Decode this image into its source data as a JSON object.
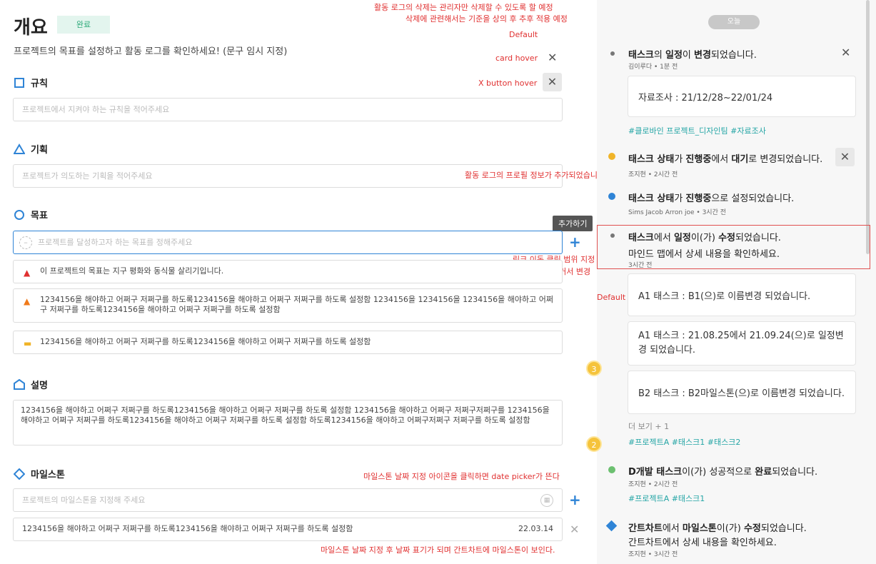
{
  "header": {
    "title": "개요",
    "status_badge": "완료",
    "subtitle": "프로젝트의 목표를 설정하고 활동 로그를 확인하세요! (문구 임시 지정)"
  },
  "sections": {
    "rules": {
      "label": "규칙",
      "placeholder": "프로젝트에서 지켜야 하는 규칙을 적어주세요"
    },
    "plan": {
      "label": "기획",
      "placeholder": "프로젝트가 의도하는 기획을 적어주세요"
    },
    "goal": {
      "label": "목표",
      "placeholder": "프로젝트를 달성하고자 하는 목표를 정해주세요",
      "add_tooltip": "추가하기",
      "items": [
        "이 프로젝트의 목표는 지구 평화와 동식물 살리기입니다.",
        "1234156을 해야하고 어쩌구 저쩌구를 하도록1234156을 해야하고 어쩌구 저쩌구를 하도록 설정함 1234156을 1234156을 1234156을 해야하고 어쩌구 저쩌구를 하도록1234156을 해야하고 어쩌구 저쩌구를 하도록 설정함",
        "1234156을 해야하고 어쩌구 저쩌구를 하도록1234156을 해야하고 어쩌구 저쩌구를 하도록 설정함"
      ]
    },
    "description": {
      "label": "설명",
      "text": "1234156을 해야하고 어쩌구 저쩌구를 하도록1234156을 해야하고 어쩌구 저쩌구를 하도록 설정함 1234156을 해야하고 어쩌구 저쩌구저쩌구를 1234156을 해야하고 어쩌구 저쩌구를 하도록1234156을 해야하고 어쩌구 저쩌구를 하도록 설정함 하도록1234156을 해야하고 어쩌구저쩌구 저쩌구를 하도록 설정함"
    },
    "milestone": {
      "label": "마일스톤",
      "placeholder": "프로젝트의 마일스톤을 지정해 주세요",
      "items": [
        {
          "text": "1234156을 해야하고 어쩌구 저쩌구를 하도록1234156을 해야하고 어쩌구 저쩌구를 하도록 설정함",
          "date": "22.03.14"
        }
      ]
    }
  },
  "annotations": {
    "delete_note_1": "활동 로그의 삭제는 관리자만 삭제할 수 있도록 할 예정",
    "delete_note_2": "삭제에 관련해서는 기준을 상의 후 추후 적용 예정",
    "default_1": "Default",
    "card_hover": "card hover",
    "x_button_hover": "X button hover",
    "profile_note": "활동 로그의 프로필 정보가 추가되었습니다.",
    "link_note": "링크 이동 클릭 범위 지정",
    "hover_note": "해당 텍스트 영역에 호버시 마우스 커서 변경",
    "default_2": "Default",
    "datepicker_note": "마일스톤 날짜 지정 아이콘을 클릭하면 date picker가 뜬다",
    "milestone_after_note": "마일스톤 날짜 지정 후 날짜 표기가 되며 간트차트에 마일스톤이 보인다."
  },
  "timeline": {
    "today_label": "오늘",
    "entries": [
      {
        "title_parts": [
          "태스크",
          "의 ",
          "일정",
          "이 ",
          "변경",
          "되었습니다."
        ],
        "meta": "김이루다 • 1분 전",
        "card": "자료조사 : 21/12/28~22/01/24",
        "tags": "#클로바인 프로젝트_디자인팀   #자료조사"
      },
      {
        "title_parts": [
          "태스크 상태",
          "가 ",
          "진행중",
          "에서 ",
          "대기",
          "로 변경되었습니다."
        ],
        "meta": "조지현 • 2시간 전"
      },
      {
        "title_parts": [
          "태스크 상태",
          "가 ",
          "진행중",
          "으로 설정되었습니다."
        ],
        "meta": "Sims Jacob Arron joe • 3시간 전"
      },
      {
        "title_parts": [
          "태스크",
          "에서 ",
          "일정",
          "이(가) ",
          "수정",
          "되었습니다."
        ],
        "line2": "마인드 맵에서 상세 내용을 확인하세요.",
        "meta": "3시간 전",
        "cards": [
          "A1 태스크 : B1(으)로 이름변경 되었습니다.",
          "A1 태스크 : 21.08.25에서 21.09.24(으)로 일정변경 되었습니다.",
          "B2 태스크 :  B2마일스톤(으)로 이름변경 되었습니다."
        ],
        "more": "더 보기 + 1",
        "tags": "#프로젝트A   #태스크1   #태스크2"
      },
      {
        "title_parts": [
          "D개발 태스크",
          "이(가) 성공적으로 ",
          "완료",
          "되었습니다."
        ],
        "meta": "조지현 • 2시간 전",
        "tags": "#프로젝트A   #태스크1"
      },
      {
        "title_parts": [
          "간트차트",
          "에서 ",
          "마일스톤",
          "이(가) ",
          "수정",
          "되었습니다."
        ],
        "line2": "간트차트에서 상세 내용을 확인하세요.",
        "meta": "조지현 • 3시간 전"
      }
    ],
    "badges": [
      "3",
      "2"
    ]
  }
}
